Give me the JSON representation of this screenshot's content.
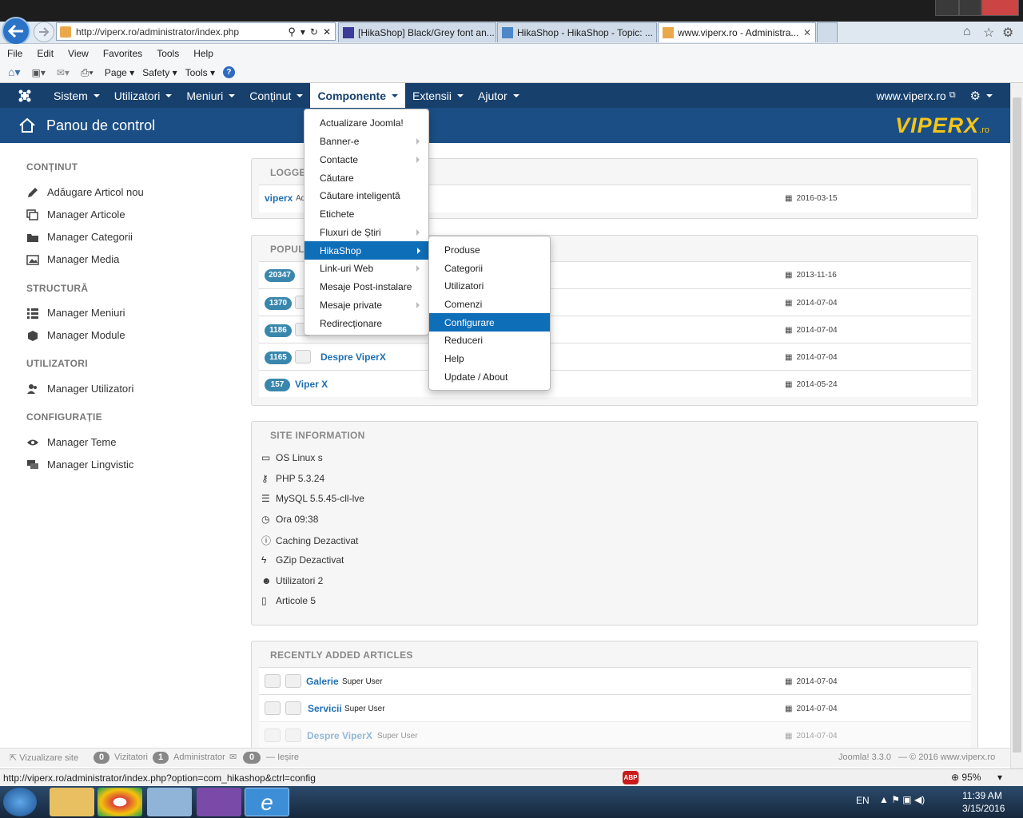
{
  "browser": {
    "address": "http://viperx.ro/administrator/index.php",
    "tabs": [
      {
        "label": "[HikaShop] Black/Grey font an..."
      },
      {
        "label": "HikaShop - HikaShop - Topic: ..."
      },
      {
        "label": "www.viperx.ro - Administra..."
      }
    ],
    "menu": [
      "File",
      "Edit",
      "View",
      "Favorites",
      "Tools",
      "Help"
    ],
    "commands": {
      "page": "Page",
      "safety": "Safety",
      "tools": "Tools"
    },
    "status_url": "http://viperx.ro/administrator/index.php?option=com_hikashop&ctrl=config",
    "abp": "ABP",
    "zoom": "95%"
  },
  "joomla": {
    "nav": [
      "Sistem",
      "Utilizatori",
      "Meniuri",
      "Conținut",
      "Componente",
      "Extensii",
      "Ajutor"
    ],
    "site_link": "www.viperx.ro",
    "header_title": "Panou de control",
    "logo_text": "VIPERX",
    "logo_suffix": ".ro"
  },
  "sidebar": {
    "sections": [
      {
        "title": "CONȚINUT",
        "items": [
          "Adăugare Articol nou",
          "Manager Articole",
          "Manager Categorii",
          "Manager Media"
        ]
      },
      {
        "title": "STRUCTURĂ",
        "items": [
          "Manager Meniuri",
          "Manager Module"
        ]
      },
      {
        "title": "UTILIZATORI",
        "items": [
          "Manager Utilizatori"
        ]
      },
      {
        "title": "CONFIGURAȚIE",
        "items": [
          "Manager Teme",
          "Manager Lingvistic"
        ]
      }
    ]
  },
  "logged": {
    "title": "LOGGE",
    "user": "viperx",
    "user_tail": "Ad",
    "date": "2016-03-15"
  },
  "popular": {
    "title": "POPUL",
    "rows": [
      {
        "hits": "20347",
        "title": "",
        "date": "2013-11-16"
      },
      {
        "hits": "1370",
        "title": "",
        "date": "2014-07-04"
      },
      {
        "hits": "1186",
        "title": "",
        "date": "2014-07-04"
      },
      {
        "hits": "1165",
        "title": "Despre ViperX",
        "date": "2014-07-04"
      },
      {
        "hits": "157",
        "title": "Viper X",
        "date": "2014-05-24"
      }
    ]
  },
  "site_info": {
    "title": "SITE INFORMATION",
    "rows": [
      "OS Linux s",
      "PHP 5.3.24",
      "MySQL 5.5.45-cll-lve",
      "Ora 09:38",
      "Caching Dezactivat",
      "GZip Dezactivat",
      "Utilizatori 2",
      "Articole 5"
    ]
  },
  "recent": {
    "title": "RECENTLY ADDED ARTICLES",
    "rows": [
      {
        "title": "Galerie",
        "author": "Super User",
        "date": "2014-07-04"
      },
      {
        "title": "Servicii",
        "author": "Super User",
        "date": "2014-07-04"
      },
      {
        "title": "Despre ViperX",
        "author": "Super User",
        "date": "2014-07-04"
      }
    ]
  },
  "componente_menu": [
    "Actualizare Joomla!",
    "Banner-e",
    "Contacte",
    "Căutare",
    "Căutare inteligentă",
    "Etichete",
    "Fluxuri de Știri",
    "HikaShop",
    "Link-uri Web",
    "Mesaje Post-instalare",
    "Mesaje private",
    "Redirecționare"
  ],
  "hikashop_menu": [
    "Produse",
    "Categorii",
    "Utilizatori",
    "Comenzi",
    "Configurare",
    "Reduceri",
    "Help",
    "Update / About"
  ],
  "footer": {
    "view_site": "Vizualizare site",
    "visitors_count": "0",
    "visitors": "Vizitatori",
    "admins_count": "1",
    "admins": "Administrator",
    "messages_count": "0",
    "logout": "Ieșire",
    "version": "Joomla! 3.3.0",
    "copyright": "— © 2016 www.viperx.ro"
  },
  "taskbar": {
    "lang": "EN",
    "time": "11:39 AM",
    "date": "3/15/2016"
  },
  "colors": {
    "nav_bg": "#17406d",
    "header_bg": "#1b4e84",
    "accent": "#0f6eb8",
    "badge": "#3a87ad",
    "logo": "#f5c518"
  }
}
